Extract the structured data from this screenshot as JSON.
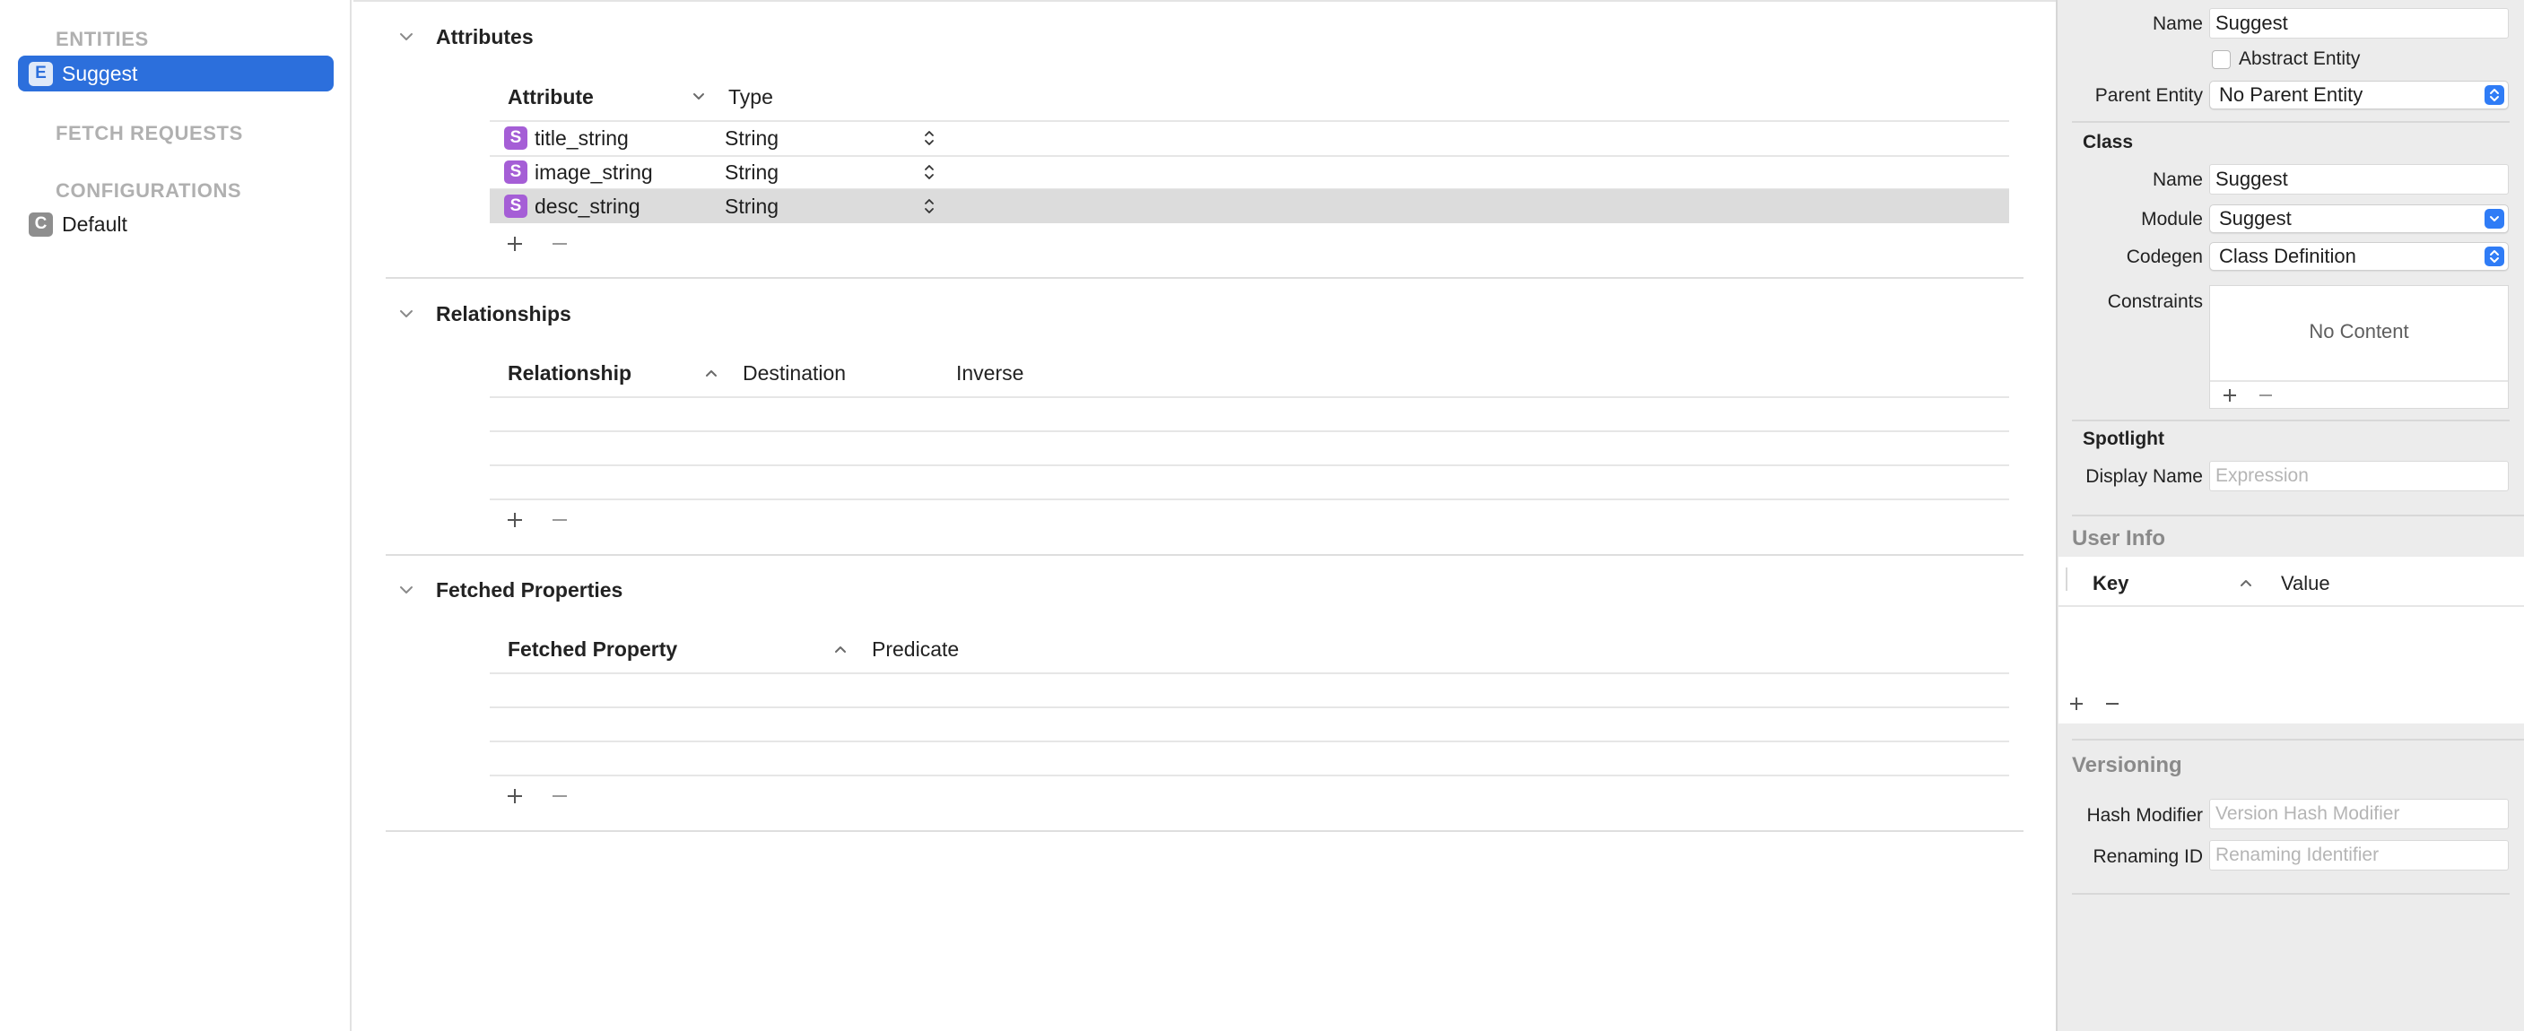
{
  "sidebar": {
    "sections": {
      "entities": "ENTITIES",
      "fetch_requests": "FETCH REQUESTS",
      "configurations": "CONFIGURATIONS"
    },
    "entities": [
      {
        "badge": "E",
        "label": "Suggest",
        "selected": true
      }
    ],
    "configurations": [
      {
        "badge": "C",
        "label": "Default"
      }
    ]
  },
  "main": {
    "attributes": {
      "title": "Attributes",
      "col_attribute": "Attribute",
      "col_type": "Type",
      "rows": [
        {
          "badge": "S",
          "name": "title_string",
          "type": "String"
        },
        {
          "badge": "S",
          "name": "image_string",
          "type": "String"
        },
        {
          "badge": "S",
          "name": "desc_string",
          "type": "String",
          "selected": true
        }
      ]
    },
    "relationships": {
      "title": "Relationships",
      "col_relationship": "Relationship",
      "col_destination": "Destination",
      "col_inverse": "Inverse"
    },
    "fetched_properties": {
      "title": "Fetched Properties",
      "col_fetched_property": "Fetched Property",
      "col_predicate": "Predicate"
    }
  },
  "inspector": {
    "name_label": "Name",
    "name_value": "Suggest",
    "abstract_label": "Abstract Entity",
    "parent_label": "Parent Entity",
    "parent_value": "No Parent Entity",
    "class_heading": "Class",
    "class_name_label": "Name",
    "class_name_value": "Suggest",
    "module_label": "Module",
    "module_value": "Suggest",
    "codegen_label": "Codegen",
    "codegen_value": "Class Definition",
    "constraints_label": "Constraints",
    "constraints_empty": "No Content",
    "spotlight_heading": "Spotlight",
    "display_name_label": "Display Name",
    "display_name_placeholder": "Expression",
    "user_info_heading": "User Info",
    "col_key": "Key",
    "col_value": "Value",
    "versioning_heading": "Versioning",
    "hash_modifier_label": "Hash Modifier",
    "hash_modifier_placeholder": "Version Hash Modifier",
    "renaming_id_label": "Renaming ID",
    "renaming_id_placeholder": "Renaming Identifier"
  },
  "colors": {
    "selection_blue": "#2c6fdc",
    "attribute_badge_purple": "#a55ed6",
    "popup_arrow_blue": "#2f7cf6"
  }
}
